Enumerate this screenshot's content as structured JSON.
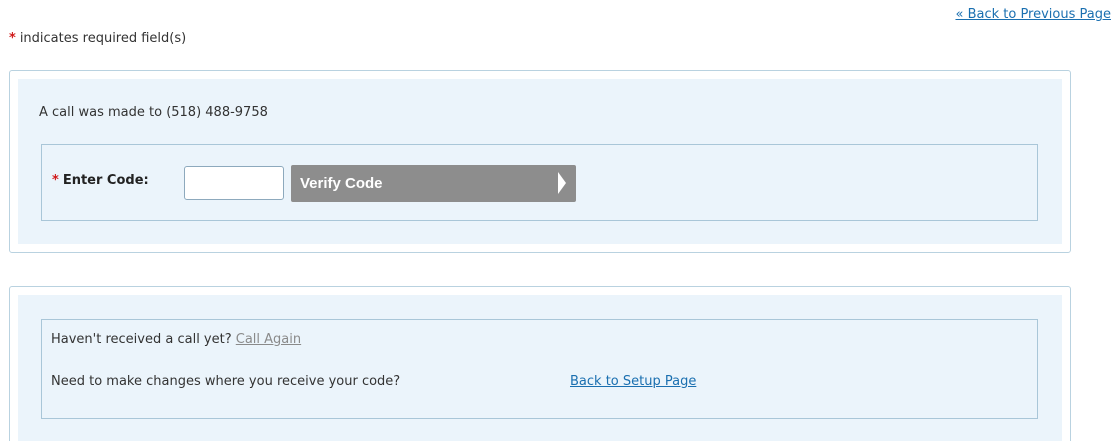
{
  "header": {
    "back_link": "« Back to Previous Page",
    "required_asterisk": "*",
    "required_note": "indicates required field(s)"
  },
  "verify_panel": {
    "call_message": "A call was made to (518) 488-9758",
    "code_asterisk": "*",
    "code_label": "Enter Code:",
    "code_input_value": "",
    "verify_button_label": "Verify Code"
  },
  "help_panel": {
    "not_received_text": "Haven't received a call yet?",
    "call_again_link": "Call Again",
    "changes_text": "Need to make changes where you receive your code?",
    "setup_link": "Back to Setup Page"
  },
  "colors": {
    "link": "#1a6fb0",
    "required": "#d01919",
    "panel_bg": "#ebf4fb",
    "button_bg": "#8d8d8d"
  }
}
